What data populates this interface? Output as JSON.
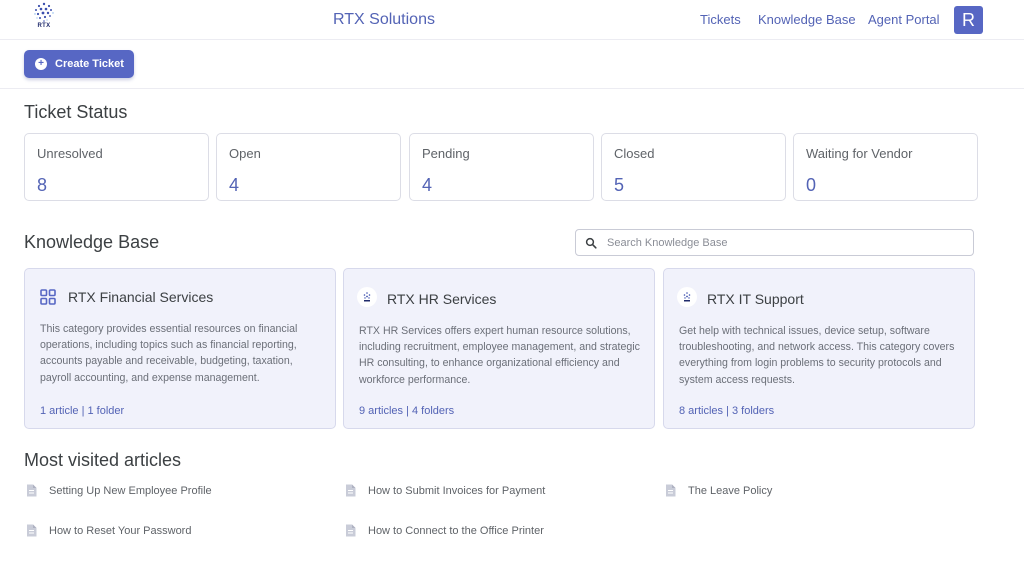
{
  "header": {
    "logo_text": "RTX",
    "title": "RTX Solutions",
    "nav": [
      "Tickets",
      "Knowledge Base",
      "Agent Portal"
    ],
    "avatar_letter": "R"
  },
  "toolbar": {
    "create_label": "Create Ticket"
  },
  "ticket_status": {
    "heading": "Ticket Status",
    "cards": [
      {
        "label": "Unresolved",
        "count": "8"
      },
      {
        "label": "Open",
        "count": "4"
      },
      {
        "label": "Pending",
        "count": "4"
      },
      {
        "label": "Closed",
        "count": "5"
      },
      {
        "label": "Waiting for Vendor",
        "count": "0"
      }
    ]
  },
  "knowledge_base": {
    "heading": "Knowledge Base",
    "search_placeholder": "Search Knowledge Base",
    "categories": [
      {
        "title": "RTX Financial Services",
        "icon": "grid-icon",
        "description": "This category provides essential resources on financial operations, including topics such as financial reporting, accounts payable and receivable, budgeting, taxation, payroll accounting, and expense management.",
        "meta": "1 article  |  1 folder"
      },
      {
        "title": "RTX HR Services",
        "icon": "rtx-logo-icon",
        "description": "RTX HR Services offers expert human resource solutions, including recruitment, employee management, and strategic HR consulting, to enhance organizational efficiency and workforce performance.",
        "meta": "9 articles  |  4 folders"
      },
      {
        "title": "RTX IT Support",
        "icon": "rtx-logo-icon",
        "description": "Get help with technical issues, device setup, software troubleshooting, and network access. This category covers everything from login problems to security protocols and system access requests.",
        "meta": "8 articles  |  3 folders"
      }
    ]
  },
  "most_visited": {
    "heading": "Most visited articles",
    "articles": [
      "Setting Up New Employee Profile",
      "How to Submit Invoices for Payment",
      "The Leave Policy",
      "How to Reset Your Password",
      "How to Connect to the Office Printer"
    ]
  },
  "colors": {
    "accent": "#5767c4",
    "link": "#5363b5",
    "card_bg": "#f1f2fb"
  }
}
